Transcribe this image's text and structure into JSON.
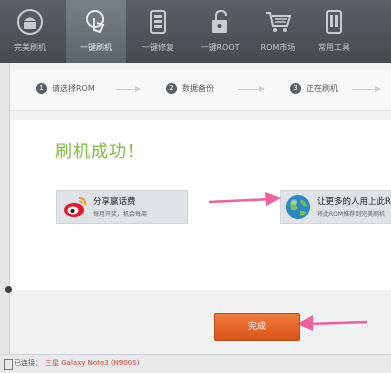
{
  "toolbar": {
    "items": [
      {
        "label": "完美刷机",
        "icon": "android-logo-icon"
      },
      {
        "label": "一键刷机",
        "icon": "hand-touch-icon"
      },
      {
        "label": "一键修复",
        "icon": "phone-repair-icon"
      },
      {
        "label": "一键ROOT",
        "icon": "unlock-icon"
      },
      {
        "label": "ROM市场",
        "icon": "cart-icon"
      },
      {
        "label": "常用工具",
        "icon": "phone-tools-icon"
      }
    ],
    "active_index": 1
  },
  "steps": [
    {
      "num": "1",
      "label": "请选择ROM"
    },
    {
      "num": "2",
      "label": "数据备份"
    },
    {
      "num": "3",
      "label": "正在刷机"
    }
  ],
  "main": {
    "success_text": "刷机成功！",
    "share_card": {
      "title": "分享赢话费",
      "subtitle": "每月开奖，机会每周",
      "icon": "weibo-icon"
    },
    "promo_card": {
      "title": "让更多的人用上此ROM",
      "subtitle": "将此ROM推荐到完美刷机",
      "icon": "globe-icon"
    },
    "done_button": "完成"
  },
  "statusbar": {
    "connection": "已连接：",
    "device": "三星 Galaxy Note3 (N900S)"
  },
  "colors": {
    "success_green": "#7dba3c",
    "button_orange": "#e8642a",
    "annotation_pink": "#f0609a"
  }
}
